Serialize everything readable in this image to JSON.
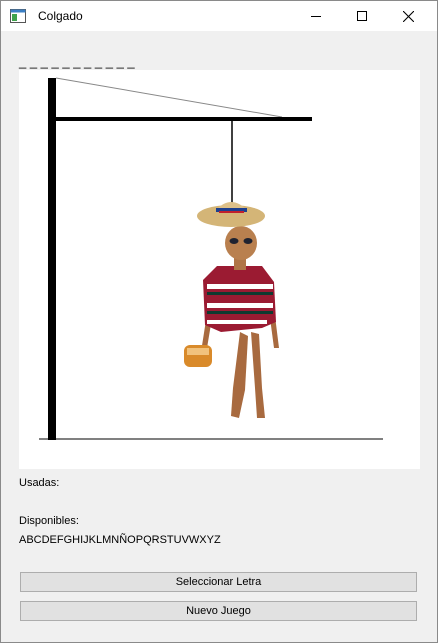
{
  "window": {
    "title": "Colgado",
    "icon": "app-window-icon"
  },
  "controls": {
    "minimize": "minimize-icon",
    "maximize": "maximize-icon",
    "close": "close-icon"
  },
  "game": {
    "hidden_word": "_ _ _ _ _ _ _ _ _ _ _",
    "used_label": "Usadas:",
    "used_letters": "",
    "available_label": "Disponibles:",
    "available_letters": "ABCDEFGHIJKLMNÑOPQRSTUVWXYZ"
  },
  "buttons": {
    "select_letter": "Seleccionar Letra",
    "new_game": "Nuevo Juego"
  },
  "colors": {
    "window_bg": "#f0f0f0",
    "button_bg": "#e1e1e1",
    "gallows": "#000000"
  }
}
